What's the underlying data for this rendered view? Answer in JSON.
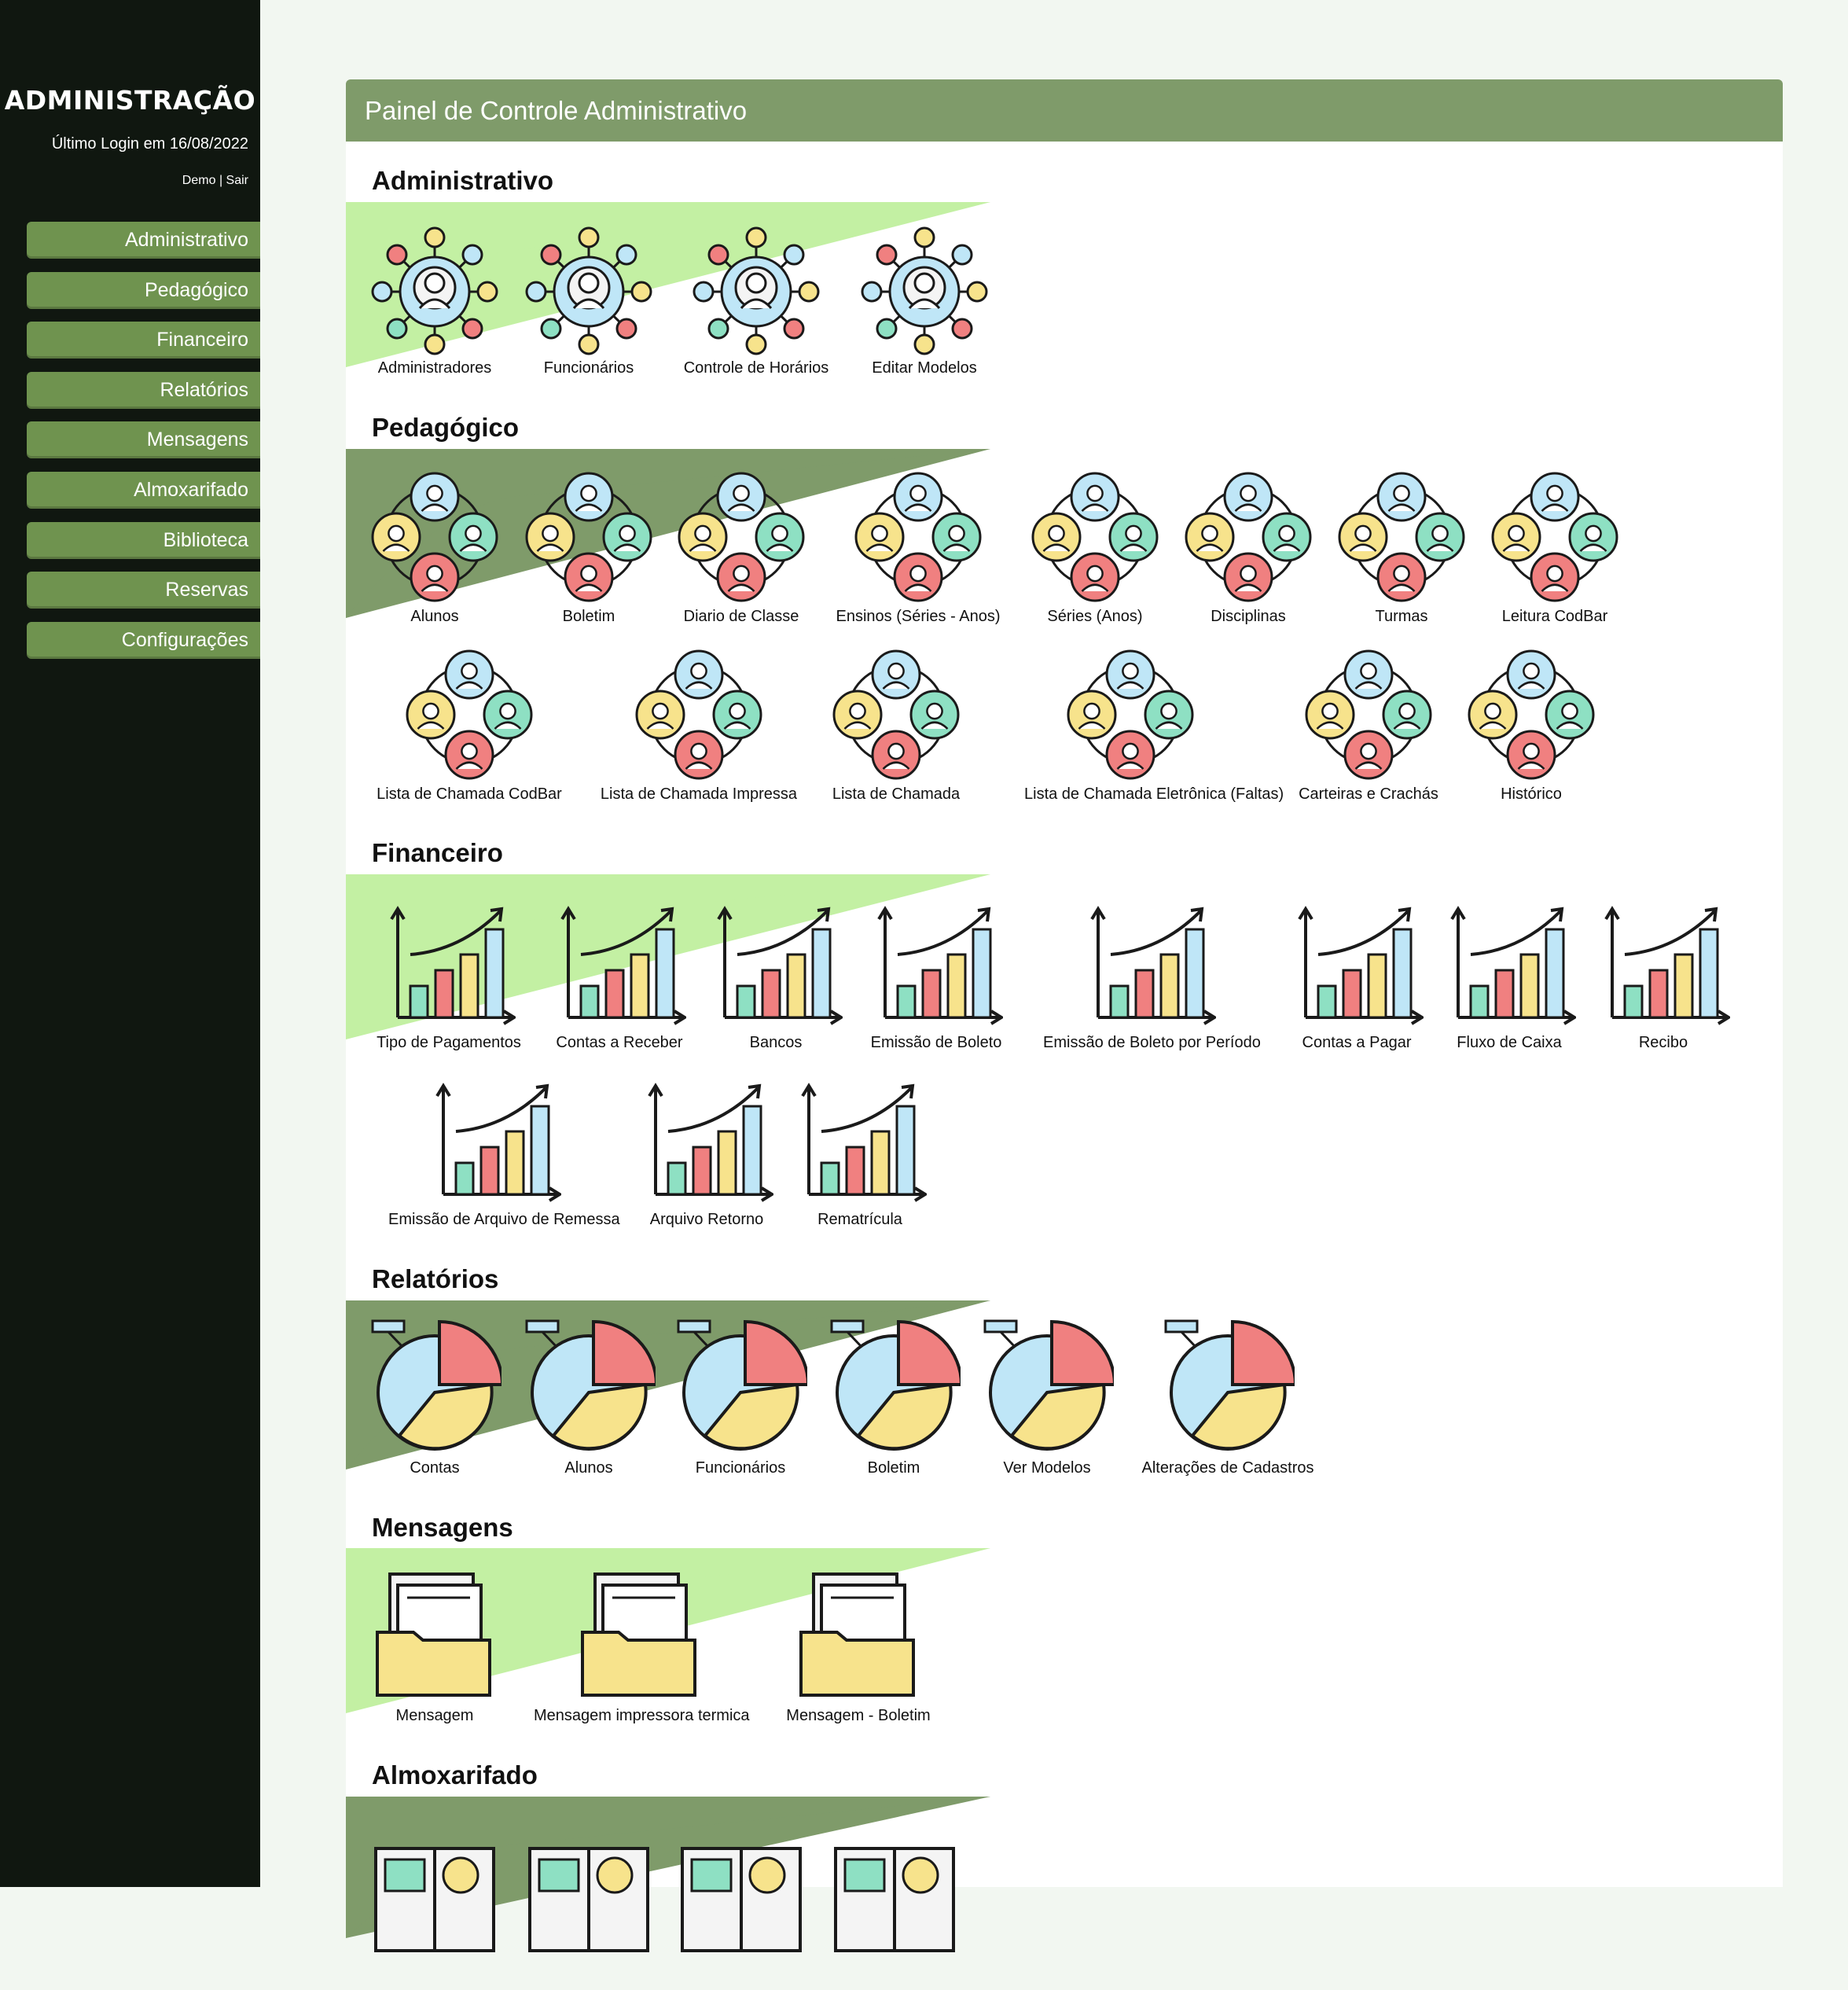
{
  "sidebar": {
    "brand": "ADMINISTRAÇÃO",
    "last_login": "Último Login em 16/08/2022",
    "user": "Demo",
    "separator": "|",
    "logout": "Sair",
    "menu": [
      {
        "label": "Administrativo"
      },
      {
        "label": "Pedagógico"
      },
      {
        "label": "Financeiro"
      },
      {
        "label": "Relatórios"
      },
      {
        "label": "Mensagens"
      },
      {
        "label": "Almoxarifado"
      },
      {
        "label": "Biblioteca"
      },
      {
        "label": "Reservas"
      },
      {
        "label": "Configurações"
      }
    ]
  },
  "panel": {
    "title": "Painel de Controle Administrativo",
    "sections": [
      {
        "title": "Administrativo",
        "icon": "network-icon",
        "band_color": "#c3f0a3",
        "items": [
          "Administradores",
          "Funcionários",
          "Controle de Horários",
          "Editar Modelos"
        ]
      },
      {
        "title": "Pedagógico",
        "icon": "group-icon",
        "band_color": "#7f9b6a",
        "items": [
          "Alunos",
          "Boletim",
          "Diario de Classe",
          "Ensinos (Séries - Anos)",
          "Séries (Anos)",
          "Disciplinas",
          "Turmas",
          "Leitura CodBar",
          "Lista de Chamada CodBar",
          "Lista de Chamada Impressa",
          "Lista de Chamada",
          "Lista de Chamada Eletrônica (Faltas)",
          "Carteiras e Crachás",
          "Histórico"
        ]
      },
      {
        "title": "Financeiro",
        "icon": "bar-chart-icon",
        "band_color": "#c3f0a3",
        "items": [
          "Tipo de Pagamentos",
          "Contas a Receber",
          "Bancos",
          "Emissão de Boleto",
          "Emissão de Boleto por Período",
          "Contas a Pagar",
          "Fluxo de Caixa",
          "Recibo",
          "Emissão de Arquivo de Remessa",
          "Arquivo Retorno",
          "Rematrícula"
        ]
      },
      {
        "title": "Relatórios",
        "icon": "pie-chart-icon",
        "band_color": "#7f9b6a",
        "items": [
          "Contas",
          "Alunos",
          "Funcionários",
          "Boletim",
          "Ver Modelos",
          "Alterações de Cadastros"
        ]
      },
      {
        "title": "Mensagens",
        "icon": "folder-icon",
        "band_color": "#c3f0a3",
        "items": [
          "Mensagem",
          "Mensagem impressora termica",
          "Mensagem - Boletim"
        ]
      },
      {
        "title": "Almoxarifado",
        "icon": "inventory-icon",
        "band_color": "#7f9b6a",
        "items": []
      }
    ]
  },
  "colors": {
    "sidebar_bg": "#101710",
    "nav_button": "#6f934f",
    "header": "#7f9b6a",
    "light_band": "#c3f0a3",
    "icon_red": "#f08080",
    "icon_yellow": "#f7e38c",
    "icon_blue": "#bfe6f7",
    "icon_teal": "#8ee0c3"
  }
}
